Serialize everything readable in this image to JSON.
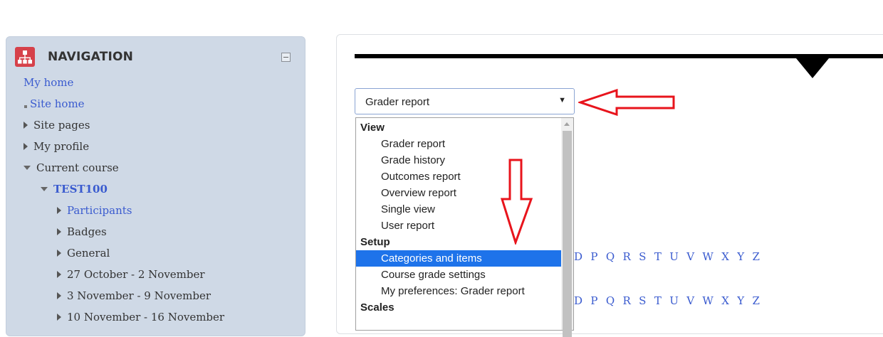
{
  "navigation": {
    "title": "NAVIGATION",
    "logo_icon": "sitemap-icon",
    "collapse_icon": "collapse-icon",
    "items": [
      {
        "label": "My home",
        "link": true,
        "indent": 0,
        "marker": "none"
      },
      {
        "label": "Site home",
        "link": true,
        "indent": 1,
        "marker": "bullet"
      },
      {
        "label": "Site pages",
        "link": false,
        "indent": 1,
        "marker": "collapsed"
      },
      {
        "label": "My profile",
        "link": false,
        "indent": 1,
        "marker": "collapsed"
      },
      {
        "label": "Current course",
        "link": false,
        "indent": 1,
        "marker": "expanded"
      },
      {
        "label": "TEST100",
        "link": true,
        "indent": 2,
        "marker": "expanded",
        "bold": true
      },
      {
        "label": "Participants",
        "link": true,
        "indent": 3,
        "marker": "collapsed"
      },
      {
        "label": "Badges",
        "link": false,
        "indent": 3,
        "marker": "collapsed"
      },
      {
        "label": "General",
        "link": false,
        "indent": 3,
        "marker": "collapsed"
      },
      {
        "label": "27 October - 2 November",
        "link": false,
        "indent": 3,
        "marker": "collapsed"
      },
      {
        "label": "3 November - 9 November",
        "link": false,
        "indent": 3,
        "marker": "collapsed"
      },
      {
        "label": "10 November - 16 November",
        "link": false,
        "indent": 3,
        "marker": "collapsed"
      }
    ]
  },
  "report_select": {
    "selected": "Grader report",
    "arrow_icon": "dropdown-arrow-icon"
  },
  "dropdown": {
    "groups": [
      {
        "label": "View",
        "options": [
          "Grader report",
          "Grade history",
          "Outcomes report",
          "Overview report",
          "Single view",
          "User report"
        ]
      },
      {
        "label": "Setup",
        "options": [
          "Categories and items",
          "Course grade settings",
          "My preferences: Grader report"
        ]
      },
      {
        "label": "Scales",
        "options": []
      }
    ],
    "highlighted": "Categories and items"
  },
  "initials_rows": [
    {
      "letters": "D P Q R S T U V W X Y Z"
    },
    {
      "letters": "D P Q R S T U V W X Y Z"
    }
  ],
  "colors": {
    "annotation": "#e8141c",
    "link": "#3a5bcf",
    "highlight": "#1e73ea",
    "nav_background": "#cfd9e6",
    "logo": "#d6414a"
  },
  "annotation_icons": [
    "red-left-arrow-icon",
    "red-down-arrow-icon"
  ]
}
